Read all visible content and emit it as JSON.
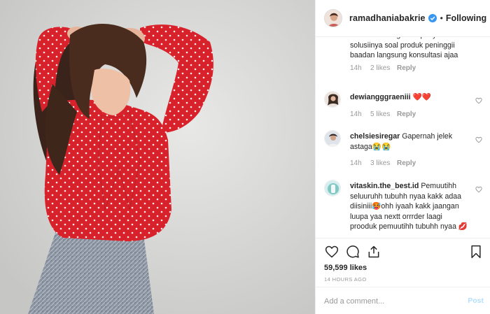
{
  "post": {
    "username": "ramadhaniabakrie",
    "separator": "•",
    "follow_label": "Following",
    "more_label": "•••",
    "photo_icon": "woman-red-polka-dot-blouse-photo"
  },
  "comments": [
    {
      "username": "",
      "text": "kamu ? Tenang kami punya solusiinya soal produk peninggii baadan langsung konsultasi ajaa",
      "time": "14h",
      "likes": "2 likes",
      "reply": "Reply",
      "has_heart": false
    },
    {
      "username": "dewiangggraeniii",
      "text": "❤️❤️",
      "time": "14h",
      "likes": "5 likes",
      "reply": "Reply",
      "has_heart": true
    },
    {
      "username": "chelsiesiregar",
      "text": "Gapernah jelek astaga😭😭",
      "time": "14h",
      "likes": "3 likes",
      "reply": "Reply",
      "has_heart": true
    },
    {
      "username": "vitaskin.the_best.id",
      "text": "Pemuutihh seluuruhh tubuhh nyaa kakk adaa diisiniii🥵ohh iyaah kakk jaangan luupa yaa nextt orrrder laagi prooduk pemuutihh tubuhh nyaa 💋",
      "has_heart": true
    }
  ],
  "footer": {
    "likes": "59,599 likes",
    "time_ago": "14 HOURS AGO",
    "icons": [
      "heart-icon",
      "comment-icon",
      "share-icon",
      "bookmark-icon"
    ]
  },
  "add_comment": {
    "placeholder": "Add a comment...",
    "post_label": "Post"
  },
  "colors": {
    "verified": "#3897f0",
    "blouse": "#d8222b",
    "post_disabled": "#b2dffc",
    "muted": "#999999"
  }
}
